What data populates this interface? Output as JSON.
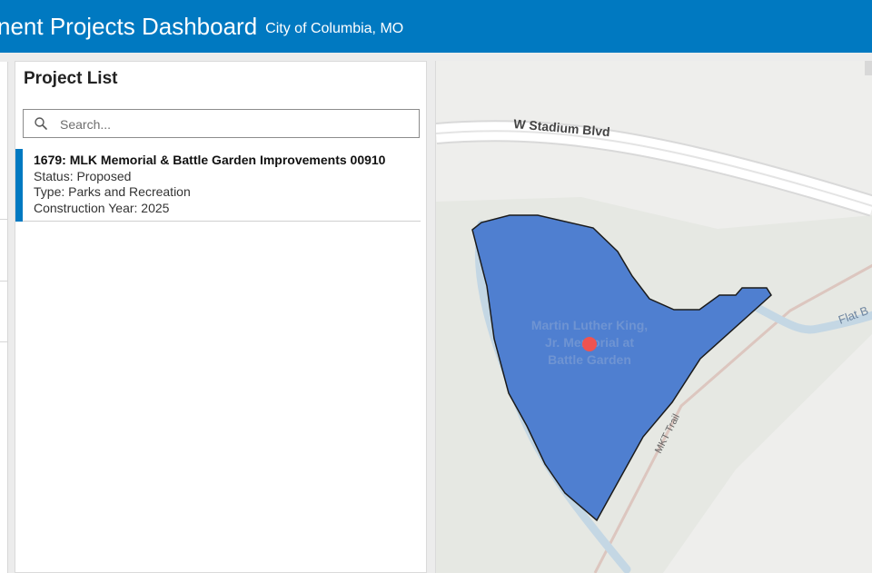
{
  "header": {
    "title": "nent Projects Dashboard",
    "subtitle": "City of Columbia, MO"
  },
  "project_list": {
    "title": "Project List",
    "search": {
      "placeholder": "Search...",
      "value": ""
    },
    "items": [
      {
        "name": "1679: MLK Memorial & Battle Garden Improvements 00910",
        "status": "Status: Proposed",
        "type": "Type: Parks and Recreation",
        "year": "Construction Year: 2025"
      }
    ]
  },
  "map": {
    "road_label": "W Stadium Blvd",
    "trail_label": "MKT Trail",
    "creek_label": "Flat B",
    "area_label": [
      "Martin Luther King,",
      "Jr. Memorial at",
      "Battle Garden"
    ],
    "colors": {
      "polygon_fill": "#4f7fd0",
      "marker": "#ef5350",
      "road": "#ffffff",
      "water": "#c4d7e4"
    }
  }
}
